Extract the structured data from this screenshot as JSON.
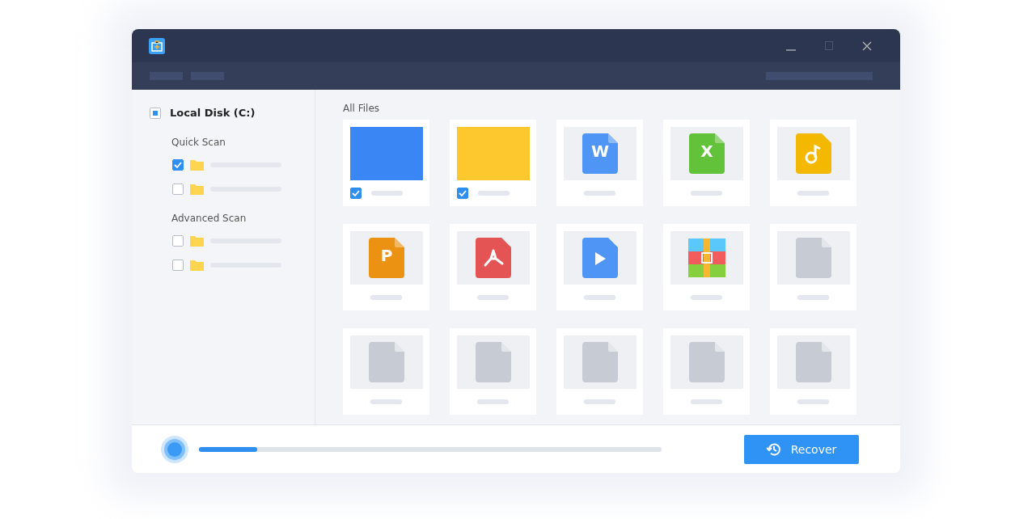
{
  "disk": {
    "label": "Local Disk (C:)",
    "partial": true
  },
  "sections": [
    {
      "title": "Quick Scan",
      "folders": [
        {
          "checked": true
        },
        {
          "checked": false
        }
      ]
    },
    {
      "title": "Advanced Scan",
      "folders": [
        {
          "checked": false
        },
        {
          "checked": false
        }
      ]
    }
  ],
  "files_title": "All Files",
  "files": [
    {
      "kind": "photo",
      "color": "#3a86f5",
      "checked": true
    },
    {
      "kind": "photo",
      "color": "#fdc72e",
      "checked": true
    },
    {
      "kind": "letter",
      "color": "#4f95f5",
      "glyph": "W",
      "checked": false
    },
    {
      "kind": "letter",
      "color": "#62c23a",
      "glyph": "X",
      "checked": false
    },
    {
      "kind": "audio",
      "color": "#f5b800",
      "checked": false
    },
    {
      "kind": "letter",
      "color": "#ec9212",
      "glyph": "P",
      "checked": false
    },
    {
      "kind": "pdf",
      "color": "#e45454",
      "checked": false
    },
    {
      "kind": "video",
      "color": "#4f95f5",
      "checked": false
    },
    {
      "kind": "archive",
      "checked": false
    },
    {
      "kind": "blank",
      "checked": false
    },
    {
      "kind": "blank",
      "checked": false
    },
    {
      "kind": "blank",
      "checked": false
    },
    {
      "kind": "blank",
      "checked": false
    },
    {
      "kind": "blank",
      "checked": false
    },
    {
      "kind": "blank",
      "checked": false
    }
  ],
  "progress": {
    "level": 0.125
  },
  "recover_button": "Recover"
}
